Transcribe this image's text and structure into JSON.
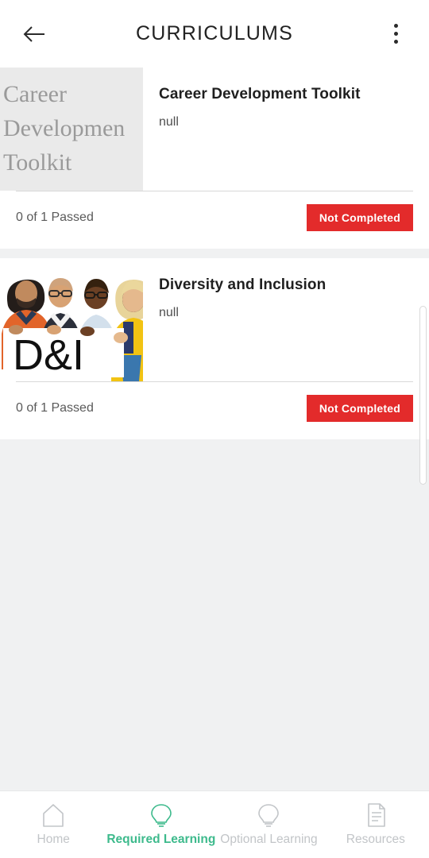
{
  "header": {
    "title": "CURRICULUMS",
    "back_icon": "arrow-left-icon",
    "menu_icon": "more-vertical-icon"
  },
  "curriculums": [
    {
      "thumbnail_kind": "text-tile",
      "thumbnail_text_lines": [
        "Career",
        "Developmen",
        "Toolkit"
      ],
      "title": "Career Development Toolkit",
      "description": "null",
      "progress": "0 of 1 Passed",
      "status": "Not Completed"
    },
    {
      "thumbnail_kind": "photo",
      "thumbnail_sign_text": "D&I",
      "title": "Diversity and Inclusion",
      "description": "null",
      "progress": "0 of 1 Passed",
      "status": "Not Completed"
    }
  ],
  "bottom_nav": {
    "items": [
      {
        "label": "Home",
        "icon": "home-icon",
        "active": false
      },
      {
        "label": "Required Learning",
        "icon": "lightbulb-icon",
        "active": true
      },
      {
        "label": "Optional Learning",
        "icon": "lightbulb-icon",
        "active": false
      },
      {
        "label": "Resources",
        "icon": "document-icon",
        "active": false
      }
    ]
  },
  "colors": {
    "accent_green": "#3DBA8C",
    "status_red": "#E32B2B",
    "page_background": "#F0F1F2",
    "inactive_gray": "#C2C5C8"
  }
}
